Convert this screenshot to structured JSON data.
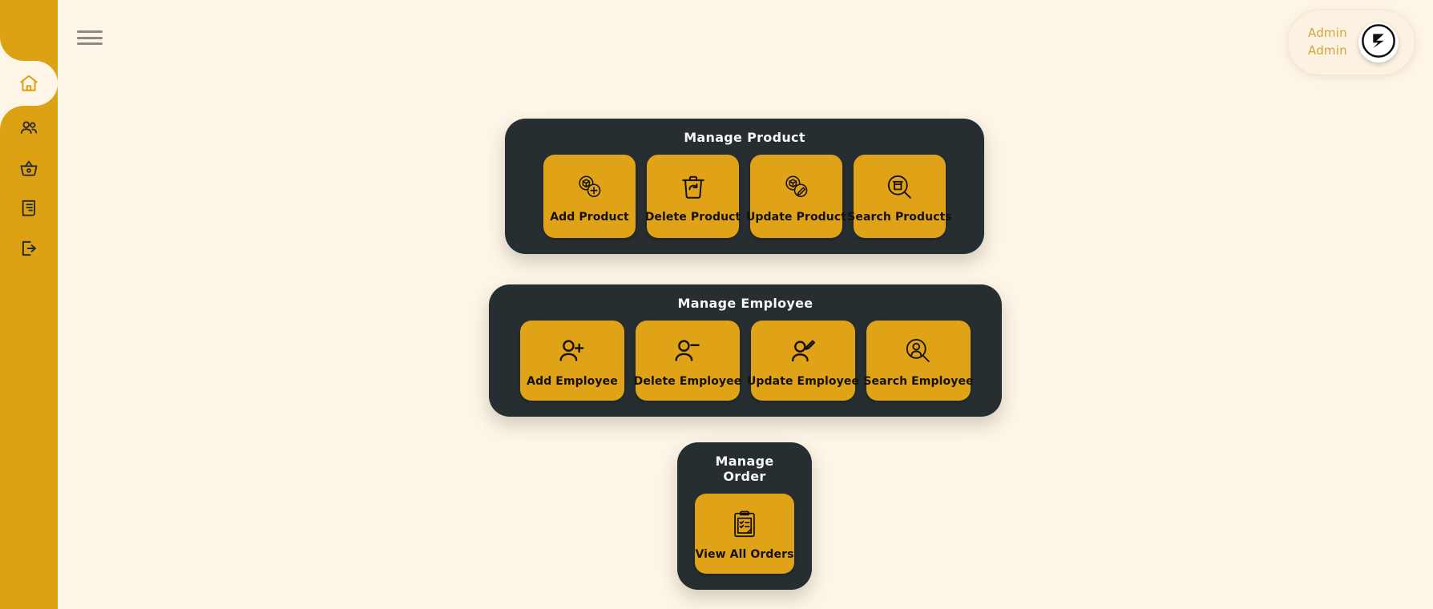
{
  "theme": {
    "sidebar_gold": "#dca213",
    "card_gold": "#e0a317",
    "panel_dark": "#262e31",
    "page_bg": "#fdf5e7",
    "accent_text": "#d3a33c"
  },
  "sidebar": {
    "items": [
      {
        "name": "home",
        "icon": "home-icon",
        "active": true
      },
      {
        "name": "users",
        "icon": "users-icon",
        "active": false
      },
      {
        "name": "basket",
        "icon": "basket-icon",
        "active": false
      },
      {
        "name": "invoice",
        "icon": "invoice-icon",
        "active": false
      },
      {
        "name": "logout",
        "icon": "logout-icon",
        "active": false
      }
    ]
  },
  "topbar": {
    "menu_icon": "hamburger-icon"
  },
  "user": {
    "line1": "Admin",
    "line2": "Admin",
    "avatar_icon": "brand-logo-icon"
  },
  "panels": [
    {
      "id": "product",
      "title": "Manage Product",
      "cards": [
        {
          "label": "Add Product",
          "icon": "box-plus-icon"
        },
        {
          "label": "Delete Product",
          "icon": "trash-restore-icon"
        },
        {
          "label": "Update Product",
          "icon": "box-pencil-icon"
        },
        {
          "label": "Search Products",
          "icon": "box-search-icon"
        }
      ]
    },
    {
      "id": "employee",
      "title": "Manage Employee",
      "cards": [
        {
          "label": "Add Employee",
          "icon": "user-plus-icon"
        },
        {
          "label": "Delete Employee",
          "icon": "user-minus-icon"
        },
        {
          "label": "Update Employee",
          "icon": "user-pencil-icon"
        },
        {
          "label": "Search Employee",
          "icon": "user-search-icon"
        }
      ]
    },
    {
      "id": "order",
      "title": "Manage Order",
      "cards": [
        {
          "label": "View All Orders",
          "icon": "clipboard-list-icon"
        }
      ]
    }
  ]
}
